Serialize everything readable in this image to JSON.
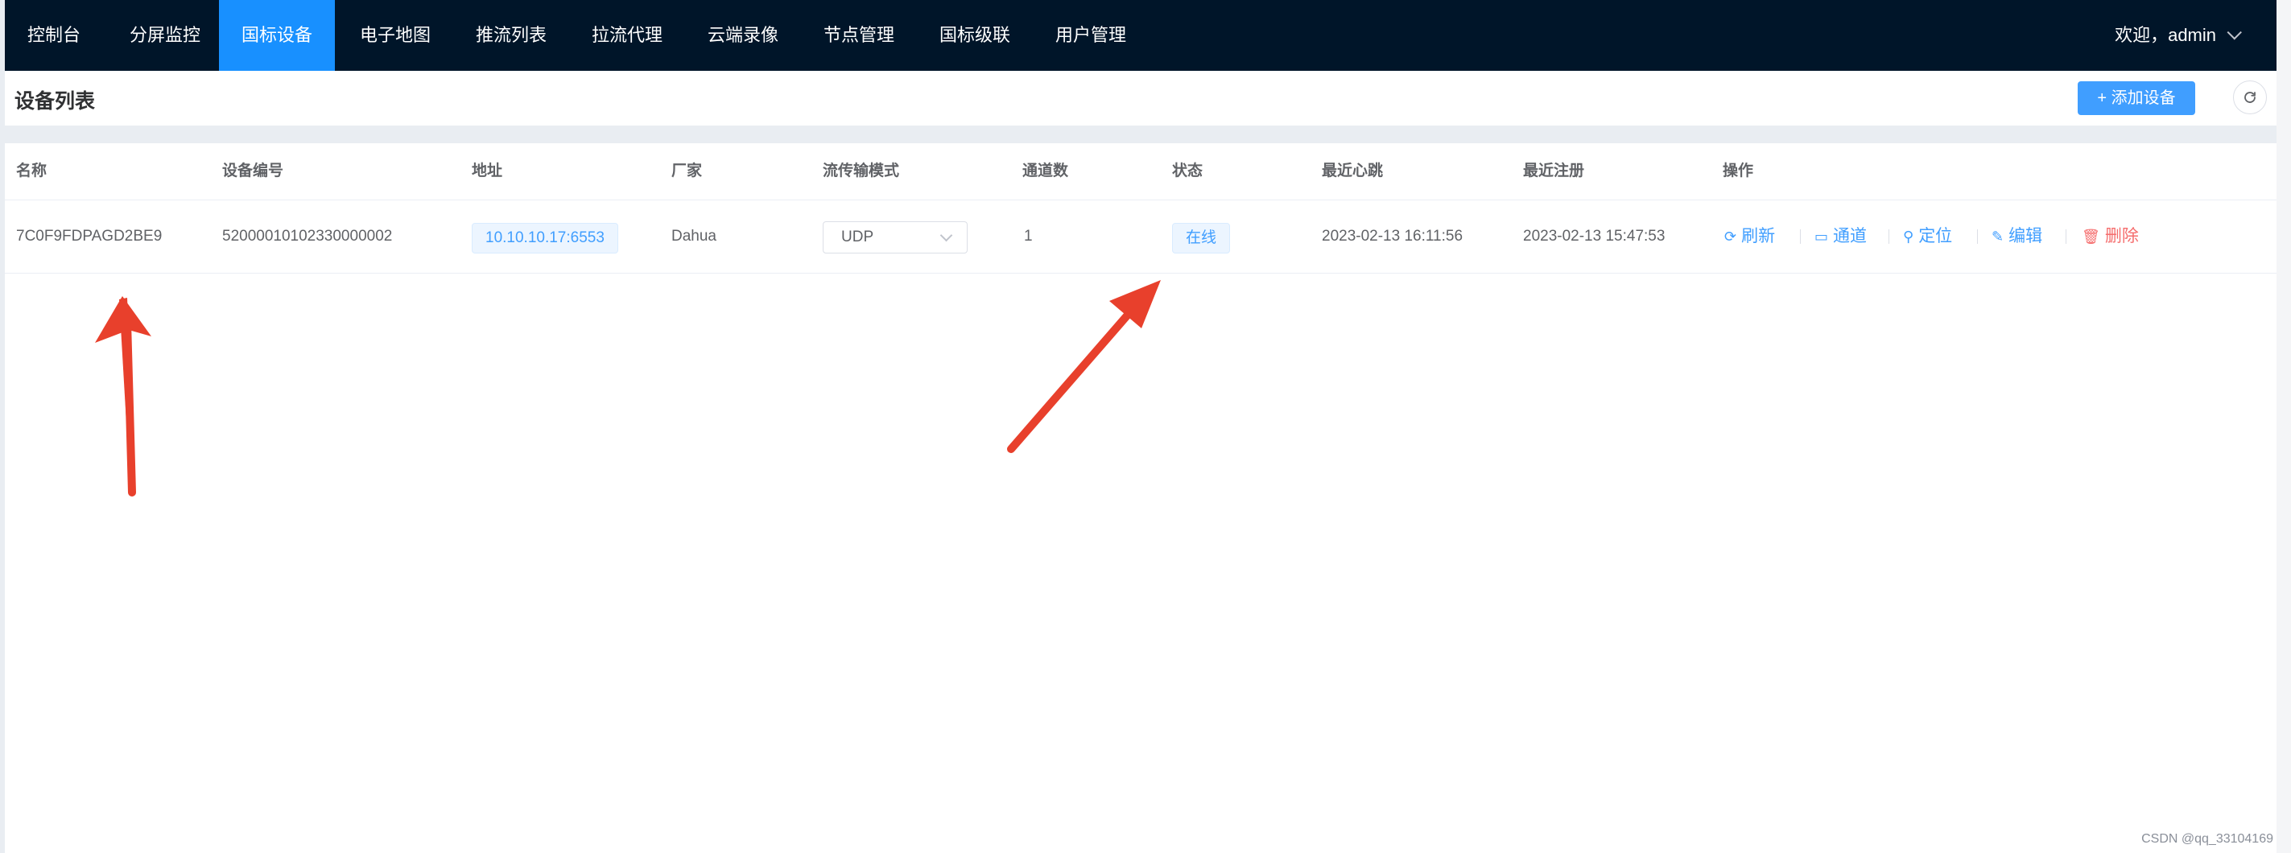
{
  "nav": {
    "items": [
      {
        "label": "控制台",
        "active": false
      },
      {
        "label": "分屏监控",
        "active": false
      },
      {
        "label": "国标设备",
        "active": true
      },
      {
        "label": "电子地图",
        "active": false
      },
      {
        "label": "推流列表",
        "active": false
      },
      {
        "label": "拉流代理",
        "active": false
      },
      {
        "label": "云端录像",
        "active": false
      },
      {
        "label": "节点管理",
        "active": false
      },
      {
        "label": "国标级联",
        "active": false
      },
      {
        "label": "用户管理",
        "active": false
      }
    ],
    "welcome": "欢迎，admin"
  },
  "header": {
    "title": "设备列表",
    "add_button": "+ 添加设备",
    "refresh_icon": "refresh-icon"
  },
  "table": {
    "columns": [
      "名称",
      "设备编号",
      "地址",
      "厂家",
      "流传输模式",
      "通道数",
      "状态",
      "最近心跳",
      "最近注册",
      "操作"
    ],
    "rows": [
      {
        "name": "7C0F9FDPAGD2BE9",
        "device_id": "52000010102330000002",
        "address": "10.10.10.17:6553",
        "vendor": "Dahua",
        "stream_mode": "UDP",
        "channels": "1",
        "status": "在线",
        "last_heartbeat": "2023-02-13 16:11:56",
        "last_register": "2023-02-13 15:47:53",
        "actions": {
          "refresh": "刷新",
          "channel": "通道",
          "locate": "定位",
          "edit": "编辑",
          "delete": "删除"
        }
      }
    ]
  },
  "annotation_color": "#e8402c",
  "accent_color": "#1890ff",
  "watermark": "CSDN @qq_33104169"
}
